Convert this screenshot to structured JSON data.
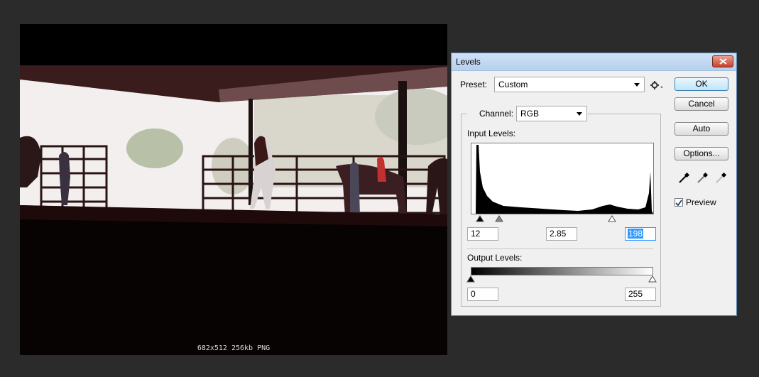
{
  "document": {
    "info": "682x512 256kb PNG"
  },
  "dialog": {
    "title": "Levels",
    "preset_label": "Preset:",
    "preset_value": "Custom",
    "channel_label": "Channel:",
    "channel_value": "RGB",
    "input_levels_label": "Input Levels:",
    "input_black": "12",
    "input_gamma": "2.85",
    "input_white": "198",
    "output_levels_label": "Output Levels:",
    "output_black": "0",
    "output_white": "255",
    "buttons": {
      "ok": "OK",
      "cancel": "Cancel",
      "auto": "Auto",
      "options": "Options..."
    },
    "preview_label": "Preview",
    "preview_checked": true,
    "icons": [
      "gear-icon",
      "close-icon",
      "black-eyedropper-icon",
      "gray-eyedropper-icon",
      "white-eyedropper-icon"
    ]
  }
}
